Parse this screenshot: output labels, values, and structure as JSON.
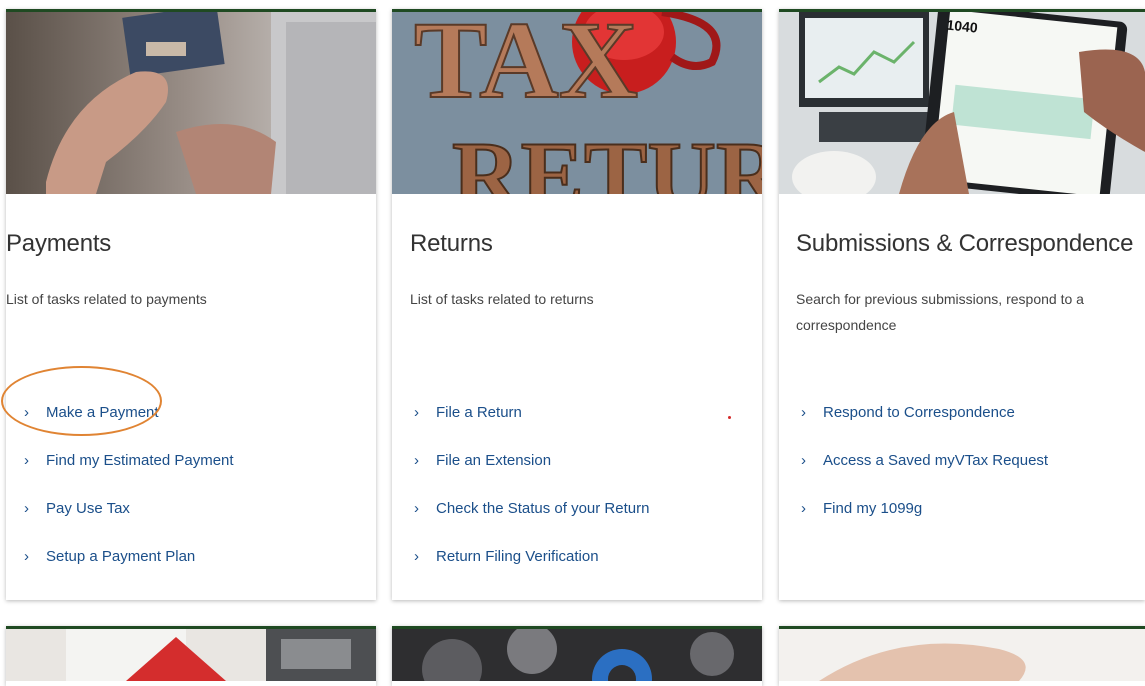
{
  "cards": [
    {
      "title": "Payments",
      "description": "List of tasks related to payments",
      "links": [
        "Make a Payment",
        "Find my Estimated Payment",
        "Pay Use Tax",
        "Setup a Payment Plan"
      ]
    },
    {
      "title": "Returns",
      "description": "List of tasks related to returns",
      "image_text": [
        "TAX",
        "RETURN"
      ],
      "links": [
        "File a Return",
        "File an Extension",
        "Check the Status of your Return",
        "Return Filing Verification"
      ]
    },
    {
      "title": "Submissions & Correspondence",
      "description": "Search for previous submissions, respond to a correspondence",
      "image_text": [
        "1040"
      ],
      "links": [
        "Respond to Correspondence",
        "Access a Saved myVTax Request",
        "Find my 1099g"
      ]
    }
  ],
  "chevron": "›",
  "colors": {
    "accent_border": "#1f4a22",
    "link": "#1b4f8a",
    "highlight": "#e08433"
  }
}
